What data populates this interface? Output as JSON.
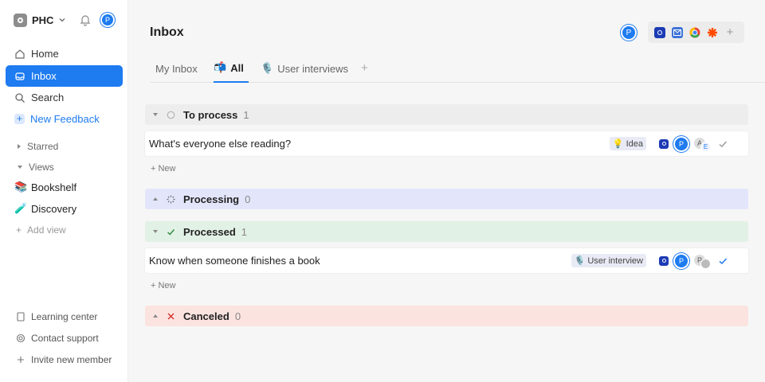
{
  "workspace": {
    "name": "PHC",
    "avatar_initial": "P"
  },
  "nav": [
    {
      "label": "Home",
      "icon": "home-icon"
    },
    {
      "label": "Inbox",
      "icon": "inbox-icon",
      "active": true
    },
    {
      "label": "Search",
      "icon": "search-icon"
    },
    {
      "label": "New Feedback",
      "icon": "plus-icon"
    }
  ],
  "groups": {
    "starred": "Starred",
    "views": "Views"
  },
  "views": [
    {
      "label": "Bookshelf",
      "emoji": "📚"
    },
    {
      "label": "Discovery",
      "emoji": "🧪"
    }
  ],
  "add_view": "Add view",
  "footer": [
    {
      "label": "Learning center",
      "icon": "book-icon"
    },
    {
      "label": "Contact support",
      "icon": "support-icon"
    },
    {
      "label": "Invite new member",
      "icon": "plus-icon"
    }
  ],
  "header": {
    "title": "Inbox",
    "avatar_initial": "P"
  },
  "integrations": [
    "intercom-icon",
    "email-icon",
    "chrome-icon",
    "zapier-icon",
    "add-icon"
  ],
  "tabs": [
    {
      "label": "My Inbox",
      "emoji": ""
    },
    {
      "label": "All",
      "emoji": "📬",
      "active": true
    },
    {
      "label": "User interviews",
      "emoji": "🎙️"
    }
  ],
  "sections": {
    "to_process": {
      "name": "To process",
      "count": "1"
    },
    "processing": {
      "name": "Processing",
      "count": "0"
    },
    "processed": {
      "name": "Processed",
      "count": "1"
    },
    "canceled": {
      "name": "Canceled",
      "count": "0"
    }
  },
  "cards": [
    {
      "title": "What's everyone else reading?",
      "tag_emoji": "💡",
      "tag": "Idea",
      "avatar": "P",
      "stack_a": "A",
      "stack_b": "E",
      "status": "unchecked"
    },
    {
      "title": "Know when someone finishes a book",
      "tag_emoji": "🎙️",
      "tag": "User interview",
      "avatar": "P",
      "stack_a": "P",
      "stack_b": "",
      "status": "checked"
    }
  ],
  "new_label": "+ New",
  "colors": {
    "accent": "#1e7bf0",
    "processing_bg": "#e3e6fb",
    "processed_bg": "#e2f1e5",
    "canceled_bg": "#fbe3df",
    "canceled_x": "#d2332c",
    "processed_check": "#2b8a3e"
  }
}
